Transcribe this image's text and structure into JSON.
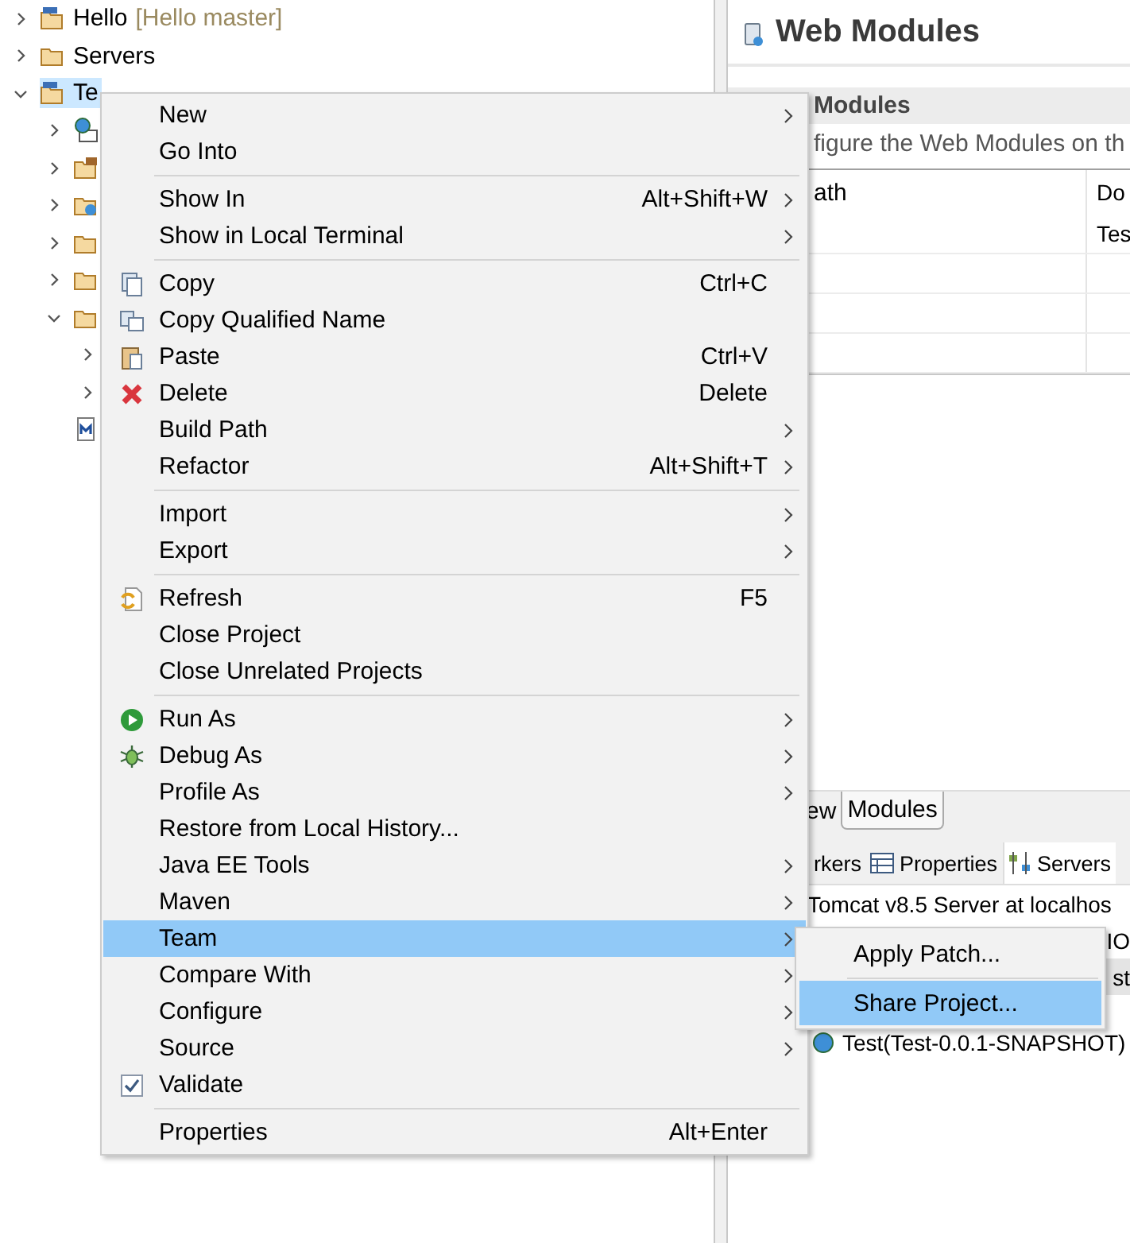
{
  "tree": [
    {
      "label": "Hello",
      "decoration": "[Hello master]",
      "kind": "project",
      "expanded": false,
      "selected": false
    },
    {
      "label": "Servers",
      "kind": "folder",
      "expanded": false,
      "selected": false
    },
    {
      "label": "Te",
      "kind": "project",
      "expanded": true,
      "selected": true,
      "children": [
        {
          "kind": "web",
          "expanded": false
        },
        {
          "kind": "package",
          "expanded": false
        },
        {
          "kind": "web-folder",
          "expanded": false
        },
        {
          "kind": "folder",
          "expanded": false
        },
        {
          "kind": "folder",
          "expanded": false
        },
        {
          "kind": "folder",
          "expanded": true,
          "children": [
            {
              "expanded": false
            },
            {
              "expanded": false
            }
          ]
        },
        {
          "kind": "file"
        }
      ]
    }
  ],
  "editor": {
    "title": "Web Modules",
    "section_title": "Modules",
    "description": "figure the Web Modules on th",
    "columns": [
      "ath",
      "Do"
    ],
    "rows": [
      {
        "column_2": "Tes"
      },
      {},
      {},
      {}
    ],
    "tabs": [
      {
        "label": "ew",
        "selected": false
      },
      {
        "label": "Modules",
        "selected": true
      }
    ]
  },
  "bottom_panel": {
    "tabs": [
      {
        "label": "rkers",
        "selected": false
      },
      {
        "label": "Properties",
        "kind": "properties",
        "selected": false
      },
      {
        "label": "Servers",
        "kind": "servers",
        "selected": true
      }
    ],
    "rows": [
      {
        "label": "Tomcat v8.5 Server at localhos",
        "kind": "server",
        "selected": false
      },
      {
        "label": "IO",
        "kind": "fragment",
        "selected": false
      },
      {
        "label": "st",
        "kind": "fragment",
        "selected": true
      },
      {
        "label": "Test(Test-0.0.1-SNAPSHOT)",
        "kind": "module",
        "selected": false
      }
    ]
  },
  "context_menu": {
    "groups": [
      [
        {
          "label": "New",
          "submenu": true,
          "selected": false
        },
        {
          "label": "Go Into",
          "submenu": false,
          "selected": false
        }
      ],
      [
        {
          "label": "Show In",
          "shortcut": "Alt+Shift+W",
          "submenu": true,
          "selected": false
        },
        {
          "label": "Show in Local Terminal",
          "submenu": true,
          "selected": false
        }
      ],
      [
        {
          "label": "Copy",
          "shortcut": "Ctrl+C",
          "kind": "copy",
          "submenu": false,
          "selected": false
        },
        {
          "label": "Copy Qualified Name",
          "kind": "copy-qualified",
          "submenu": false,
          "selected": false
        },
        {
          "label": "Paste",
          "shortcut": "Ctrl+V",
          "kind": "paste",
          "submenu": false,
          "selected": false
        },
        {
          "label": "Delete",
          "shortcut": "Delete",
          "kind": "delete",
          "submenu": false,
          "selected": false
        },
        {
          "label": "Build Path",
          "submenu": true,
          "selected": false
        },
        {
          "label": "Refactor",
          "shortcut": "Alt+Shift+T",
          "submenu": true,
          "selected": false
        }
      ],
      [
        {
          "label": "Import",
          "submenu": true,
          "selected": false
        },
        {
          "label": "Export",
          "submenu": true,
          "selected": false
        }
      ],
      [
        {
          "label": "Refresh",
          "shortcut": "F5",
          "kind": "refresh",
          "submenu": false,
          "selected": false
        },
        {
          "label": "Close Project",
          "submenu": false,
          "selected": false
        },
        {
          "label": "Close Unrelated Projects",
          "submenu": false,
          "selected": false
        }
      ],
      [
        {
          "label": "Run As",
          "kind": "run",
          "submenu": true,
          "selected": false
        },
        {
          "label": "Debug As",
          "kind": "debug",
          "submenu": true,
          "selected": false
        },
        {
          "label": "Profile As",
          "submenu": true,
          "selected": false
        },
        {
          "label": "Restore from Local History...",
          "submenu": false,
          "selected": false
        },
        {
          "label": "Java EE Tools",
          "submenu": true,
          "selected": false
        },
        {
          "label": "Maven",
          "submenu": true,
          "selected": false
        },
        {
          "label": "Team",
          "submenu": true,
          "selected": true
        },
        {
          "label": "Compare With",
          "submenu": true,
          "selected": false
        },
        {
          "label": "Configure",
          "submenu": true,
          "selected": false
        },
        {
          "label": "Source",
          "submenu": true,
          "selected": false
        },
        {
          "label": "Validate",
          "kind": "checkbox",
          "checked": true,
          "submenu": false,
          "selected": false
        }
      ],
      [
        {
          "label": "Properties",
          "shortcut": "Alt+Enter",
          "submenu": false,
          "selected": false
        }
      ]
    ]
  },
  "submenu": {
    "items": [
      {
        "label": "Apply Patch...",
        "selected": false
      },
      {
        "label": "Share Project...",
        "selected": true
      }
    ]
  }
}
